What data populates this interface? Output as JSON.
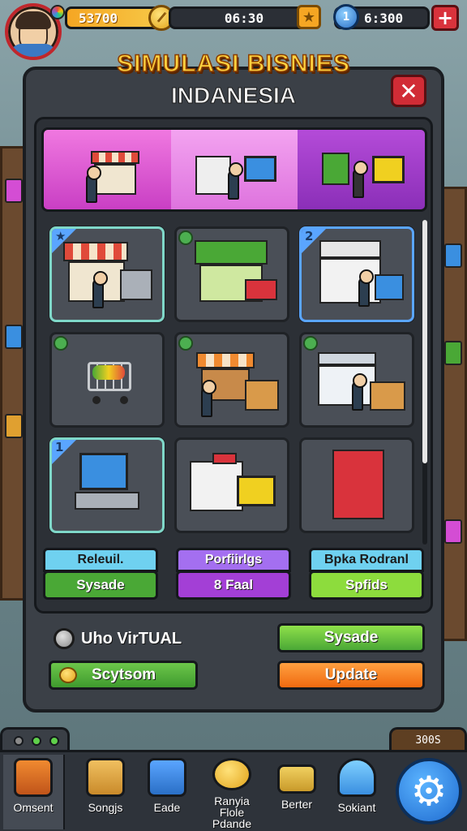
{
  "hud": {
    "money": "53700",
    "time": "06:30",
    "gems": "6:300",
    "gem_level": "1"
  },
  "title": {
    "line1": "SIMULASI BISNIES",
    "line2": "INDANESIA"
  },
  "grid": {
    "badges": [
      "",
      "",
      "2",
      "",
      "",
      "",
      "1",
      "",
      ""
    ]
  },
  "labels": [
    {
      "top": "Releuil.",
      "bottom": "Sysade"
    },
    {
      "top": "Porfiirlgs",
      "bottom": "8 Faal"
    },
    {
      "top": "Bpka Rodranl",
      "bottom": "Spfids"
    }
  ],
  "controls": {
    "radio_label": "Uho VirTUAL",
    "btn_sysade": "Sysade",
    "btn_scytsom": "Scytsom",
    "btn_update": "Update"
  },
  "nav": {
    "counter": "300S",
    "items": [
      {
        "label": "Omsent"
      },
      {
        "label": "Songjs"
      },
      {
        "label": "Eade"
      },
      {
        "label": "Ranyia Flole Pdande"
      },
      {
        "label": "Berter"
      },
      {
        "label": "Sokiant"
      }
    ]
  },
  "colors": {
    "accent_gold": "#ffd23f",
    "panel_bg": "#3b4047",
    "close_red": "#d12c36",
    "tab_magenta": "#c93fc4",
    "settings_blue": "#1f6bd0"
  }
}
